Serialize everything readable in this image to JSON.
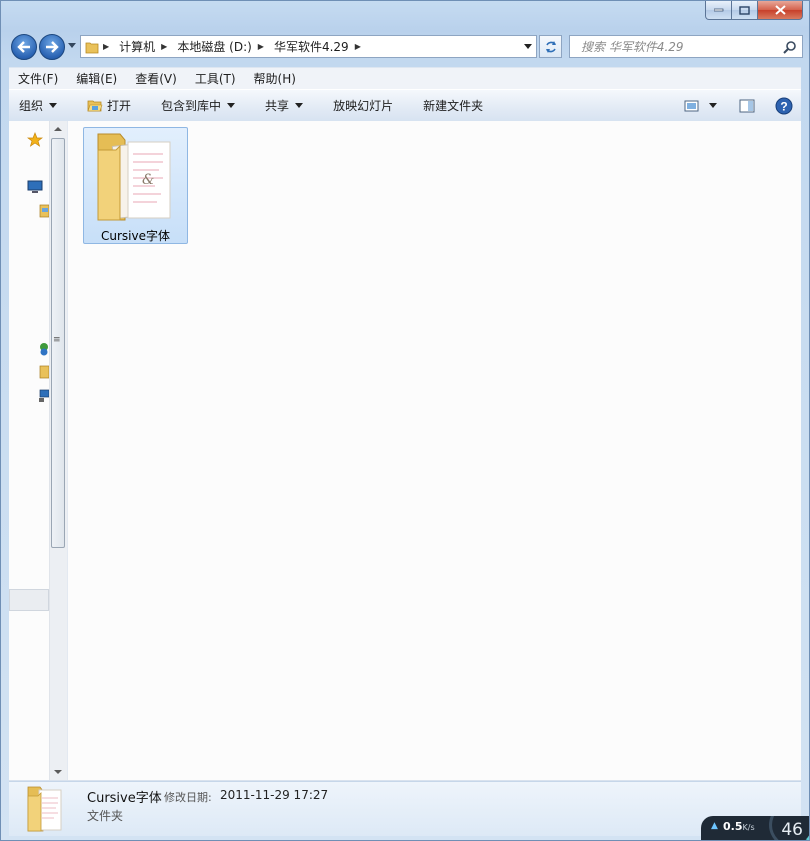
{
  "window": {
    "caption": {
      "minimize_icon": "minimize-icon",
      "maximize_icon": "maximize-icon",
      "close_icon": "close-icon"
    }
  },
  "nav": {
    "breadcrumbs": [
      "计算机",
      "本地磁盘 (D:)",
      "华军软件4.29"
    ],
    "search_placeholder": "搜索 华军软件4.29"
  },
  "menubar": {
    "items": [
      "文件(F)",
      "编辑(E)",
      "查看(V)",
      "工具(T)",
      "帮助(H)"
    ]
  },
  "toolbar": {
    "organize": "组织",
    "open": "打开",
    "include_in_library": "包含到库中",
    "share": "共享",
    "slideshow": "放映幻灯片",
    "new_folder": "新建文件夹"
  },
  "files": [
    {
      "name": "Cursive字体",
      "type": "folder",
      "selected": true
    }
  ],
  "details": {
    "name": "Cursive字体",
    "modified_label": "修改日期:",
    "modified_value": "2011-11-29 17:27",
    "type": "文件夹"
  },
  "netspeed": {
    "speed": "0.5",
    "unit": "K/s",
    "percent": "46"
  },
  "colors": {
    "selection": "#c7dff8",
    "frame": "#b9d1ec",
    "accent": "#2a63b3"
  }
}
